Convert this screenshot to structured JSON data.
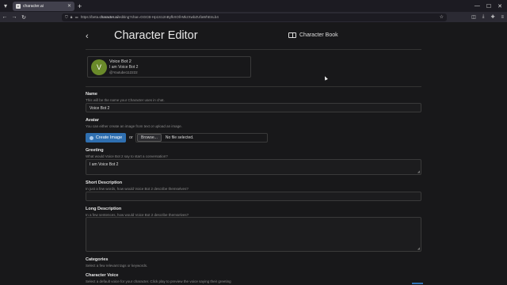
{
  "browser": {
    "tab_title": "character.ai",
    "url_prefix": "https://beta.",
    "url_domain": "character.ai",
    "url_rest": "/editing?char=GGCB-Hp1S12nByfkXOll-MkzXwbZUfaWhEnLb4"
  },
  "page": {
    "title": "Character Editor",
    "character_book_label": "Character Book"
  },
  "profile": {
    "avatar_letter": "V",
    "name": "Voice Bot 2",
    "tagline": "I am Voice Bot 2",
    "handle": "@Youtube112222"
  },
  "form": {
    "name_label": "Name",
    "name_help": "This will be the name your Character uses in chat.",
    "name_value": "Voice Bot 2",
    "avatar_label": "Avatar",
    "avatar_help": "You can either create an image from text or upload an image.",
    "create_image_label": "Create Image",
    "or_text": "or",
    "browse_label": "Browse...",
    "no_file_text": "No file selected.",
    "greeting_label": "Greeting",
    "greeting_help": "What would Voice Bot 2 say to start a conversation?",
    "greeting_value": "I am Voice Bot 2",
    "short_desc_label": "Short Description",
    "short_desc_help": "In just a few words, how would Voice Bot 2 describe themselves?",
    "short_desc_value": "",
    "long_desc_label": "Long Description",
    "long_desc_help": "In a few sentences, how would Voice Bot 2 describe themselves?",
    "long_desc_value": "",
    "categories_label": "Categories",
    "categories_help": "Select a few relevant tags or keywords.",
    "voice_label": "Character Voice",
    "voice_help": "Select a default voice for your character. Click play to preview the voice saying their greeting"
  }
}
